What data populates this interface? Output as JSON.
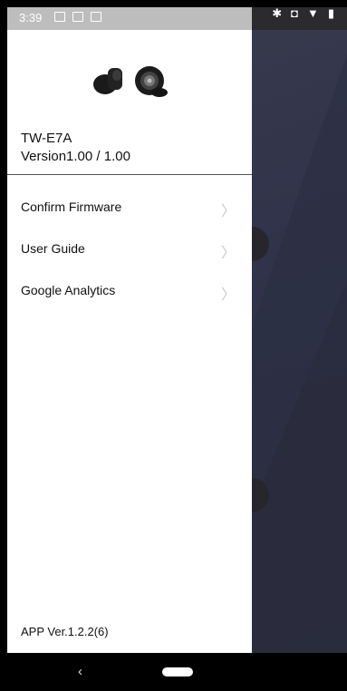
{
  "status_bar": {
    "time": "3:39",
    "left_icons": [
      "image-icon",
      "gmail-icon",
      "calendar-icon"
    ],
    "right_icons": [
      "bluetooth-icon",
      "vibrate-icon",
      "wifi-icon",
      "battery-icon"
    ]
  },
  "drawer": {
    "device": {
      "name": "TW-E7A",
      "version": "Version1.00 / 1.00"
    },
    "menu": [
      {
        "label": "Confirm Firmware",
        "icon": "chevron-right-icon"
      },
      {
        "label": "User Guide",
        "icon": "chevron-right-icon"
      },
      {
        "label": "Google Analytics",
        "icon": "chevron-right-icon"
      }
    ],
    "app_version": "APP Ver.1.2.2(6)"
  },
  "nav_bar": {
    "back_icon": "back-icon",
    "home_icon": "home-pill-icon"
  },
  "colors": {
    "drawer_bg": "#ffffff",
    "scrim": "#30334a",
    "status_bar_drawer": "#bdbdbd"
  }
}
